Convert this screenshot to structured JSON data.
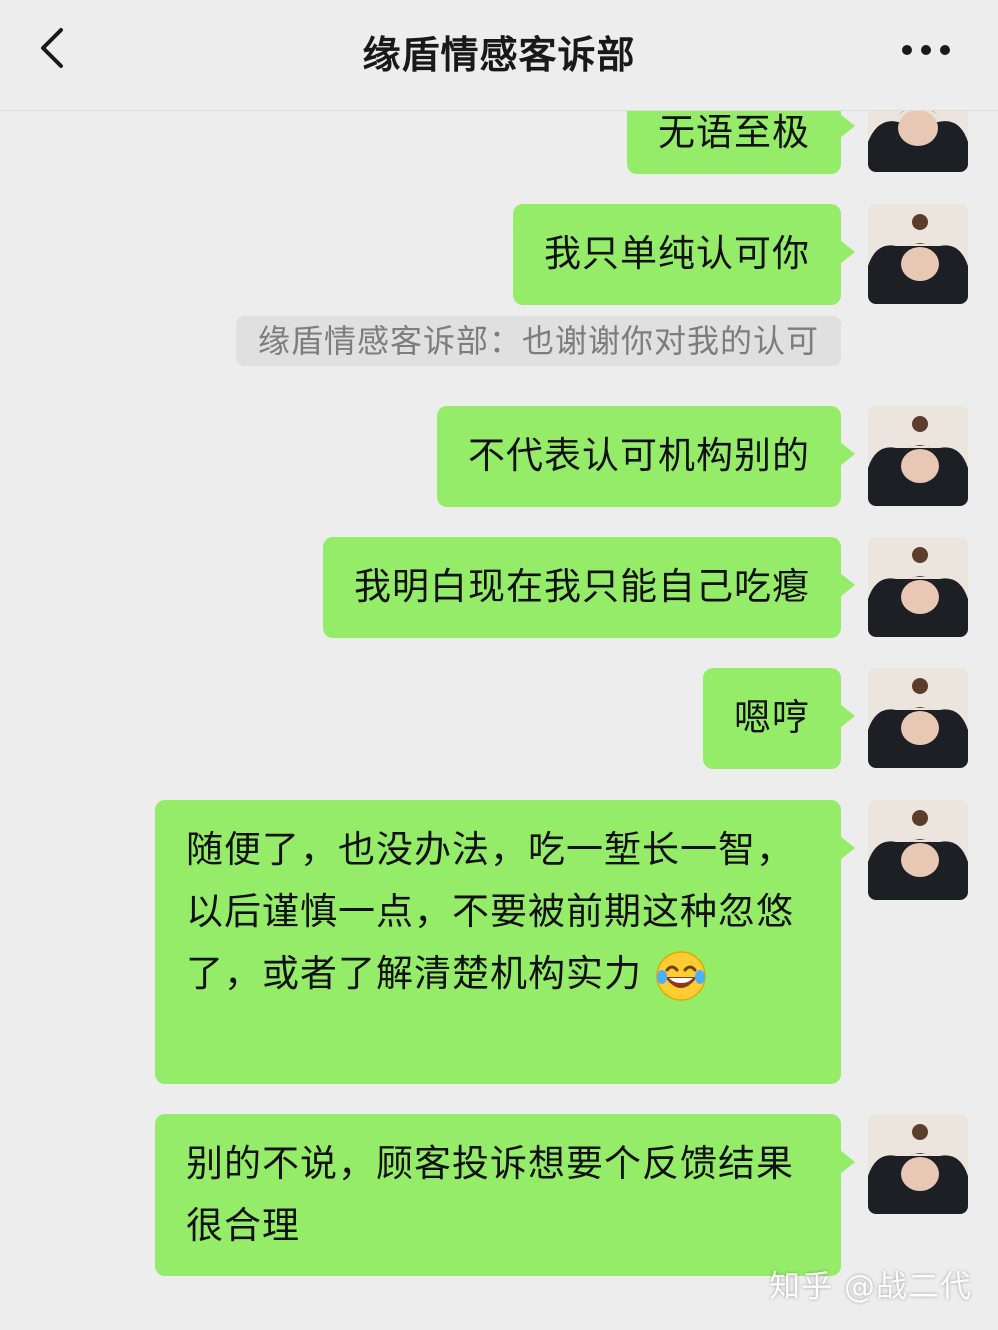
{
  "header": {
    "title": "缘盾情感客诉部",
    "back_icon": "chevron-left-icon",
    "more_icon": "more-icon"
  },
  "messages": [
    {
      "text": "无语至极"
    },
    {
      "text": "我只单纯认可你"
    },
    {
      "text": "不代表认可机构别的"
    },
    {
      "text": "我明白现在我只能自己吃瘪"
    },
    {
      "text": "嗯哼"
    },
    {
      "text": "随便了，也没办法，吃一堑长一智，以后谨慎一点，不要被前期这种忽悠了，或者了解清楚机构实力"
    },
    {
      "text": "别的不说，顾客投诉想要个反馈结果很合理"
    }
  ],
  "quote": {
    "text": "缘盾情感客诉部：也谢谢你对我的认可"
  },
  "watermark": "知乎 @战二代",
  "colors": {
    "bubble": "#95ec69",
    "background": "#ededed",
    "quote_bg": "#e0e0e0"
  }
}
